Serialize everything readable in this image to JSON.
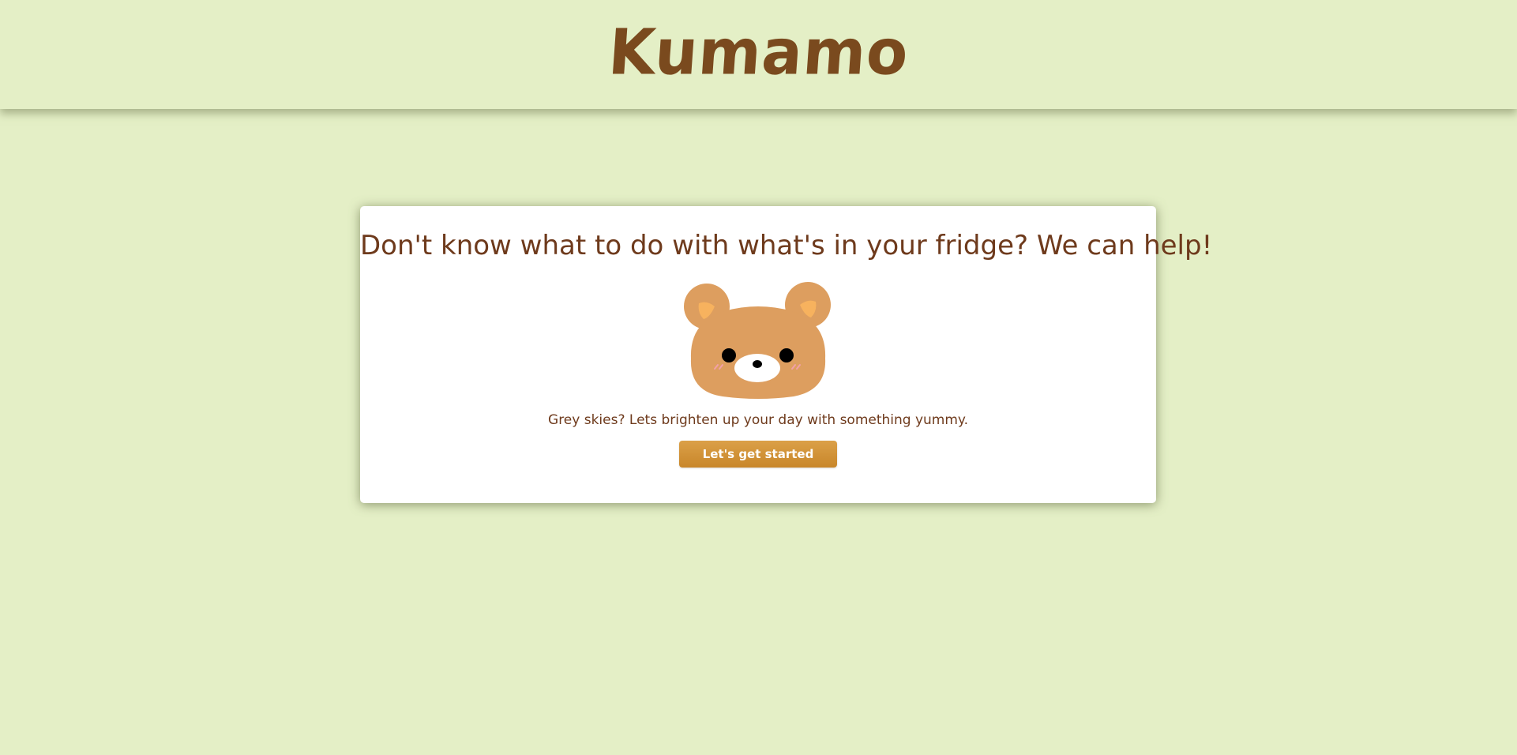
{
  "header": {
    "logo_text": "Kumamo"
  },
  "main": {
    "headline": "Don't know what to do with what's in your fridge? We can help!",
    "tagline": "Grey skies? Lets brighten up your day with something yummy.",
    "cta_label": "Let's get started",
    "mascot_icon": "bear-face-icon"
  },
  "colors": {
    "background": "#e4efc6",
    "logo": "#7a4a1e",
    "text": "#6e3a1c",
    "button": "#d09135",
    "bear_fur": "#dd9e5f",
    "bear_inner_ear": "#f7b25e"
  }
}
